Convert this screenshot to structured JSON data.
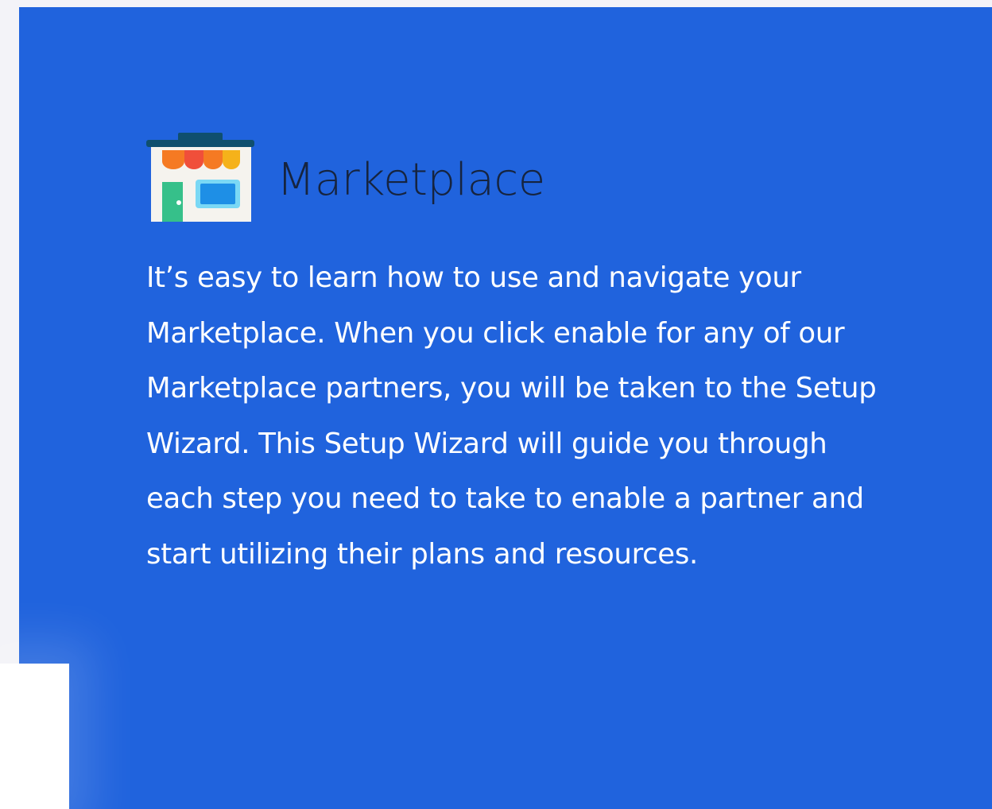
{
  "colors": {
    "panel_background": "#2063dd",
    "page_background": "#f3f3f8",
    "title_color": "#16243f",
    "body_text_color": "#ffffff"
  },
  "marketplace": {
    "icon": "store-icon",
    "title": "Marketplace",
    "description": "It’s easy to learn how to use and navigate your Marketplace. When you click enable for any of our Marketplace partners, you will be taken to the Setup Wizard. This Setup Wizard will guide you through each step you need to take to enable a partner and start utilizing their plans and resources."
  }
}
